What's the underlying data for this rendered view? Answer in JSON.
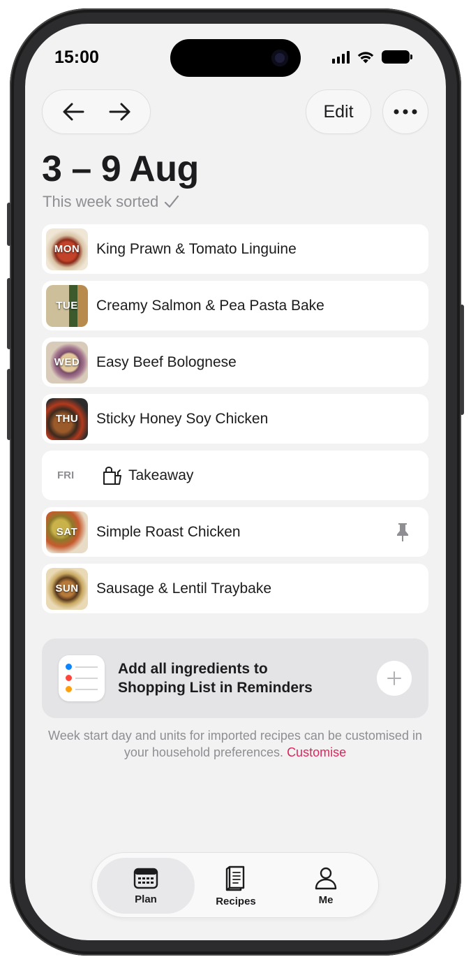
{
  "status_bar": {
    "time": "15:00"
  },
  "header": {
    "edit_label": "Edit",
    "title": "3 – 9 Aug",
    "subtitle": "This week sorted"
  },
  "meals": [
    {
      "day": "MON",
      "name": "King Prawn & Tomato Linguine"
    },
    {
      "day": "TUE",
      "name": "Creamy Salmon & Pea Pasta Bake"
    },
    {
      "day": "WED",
      "name": "Easy Beef Bolognese"
    },
    {
      "day": "THU",
      "name": "Sticky Honey Soy Chicken"
    },
    {
      "day": "FRI",
      "name": "Takeaway",
      "icon": "takeaway-bag-icon"
    },
    {
      "day": "SAT",
      "name": "Simple Roast Chicken",
      "pinned": true
    },
    {
      "day": "SUN",
      "name": "Sausage & Lentil Traybake"
    }
  ],
  "reminders": {
    "line1": "Add all ingredients to",
    "line2": "Shopping List in Reminders"
  },
  "footnote": {
    "text": "Week start day and units for imported recipes can be customised in your household preferences.",
    "link": "Customise"
  },
  "tabs": [
    {
      "label": "Plan",
      "icon": "calendar-icon",
      "active": true
    },
    {
      "label": "Recipes",
      "icon": "book-icon",
      "active": false
    },
    {
      "label": "Me",
      "icon": "person-icon",
      "active": false
    }
  ],
  "colors": {
    "accent": "#e0245e",
    "background": "#f2f2f2",
    "card": "#ffffff",
    "muted": "#8e8e93"
  }
}
